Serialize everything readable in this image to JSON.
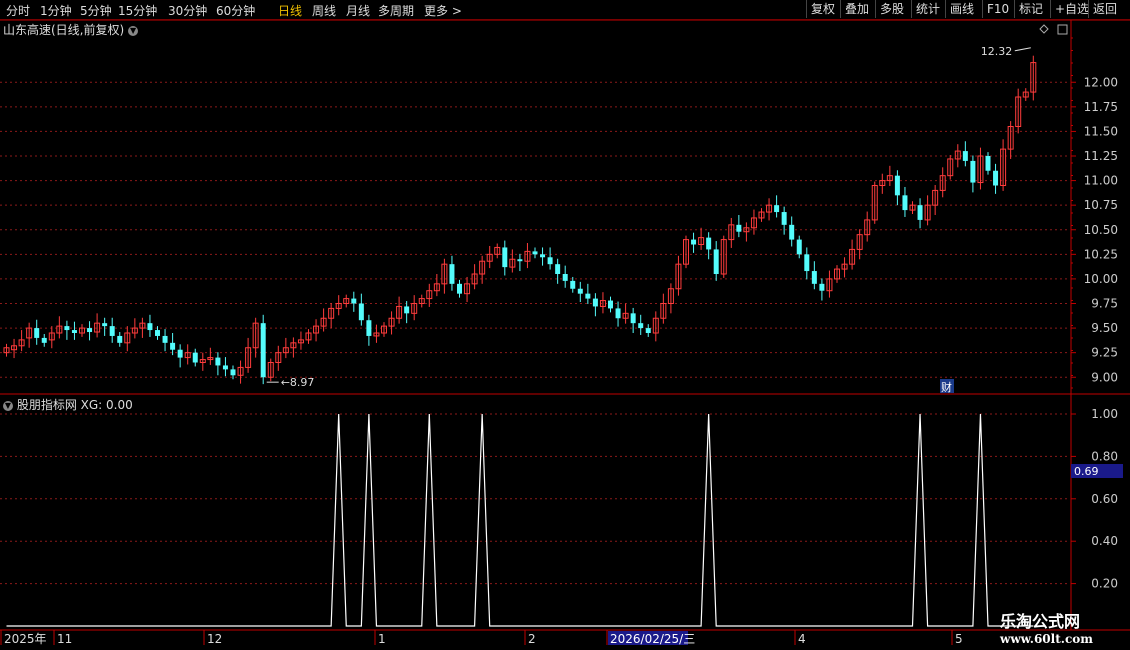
{
  "toolbar": {
    "periods": [
      "分时",
      "1分钟",
      "5分钟",
      "15分钟",
      "30分钟",
      "60分钟",
      "日线",
      "周线",
      "月线",
      "多周期",
      "更多"
    ],
    "active_period": "日线",
    "right_buttons": [
      "复权",
      "叠加",
      "多股",
      "统计",
      "画线",
      "F10",
      "标记",
      "+自选",
      "返回"
    ]
  },
  "main_chart": {
    "title": "山东高速(日线,前复权)",
    "high_label": "12.32",
    "low_label": "8.97",
    "event_badge": "财"
  },
  "indicator": {
    "title": "股朋指标网 XG: 0.00",
    "current_value": "0.69"
  },
  "time_axis": {
    "labels": [
      "2025年",
      "11",
      "12",
      "1",
      "2",
      "2026/02/25/三",
      "4",
      "5"
    ]
  },
  "watermark": {
    "line1": "乐淘公式网",
    "line2": "www.60lt.com"
  },
  "colors": {
    "up": "#ff3c3c",
    "down": "#54fcfc",
    "grid": "#8b1a1a",
    "axis": "#c00000"
  },
  "chart_data": [
    {
      "type": "candlestick",
      "title": "山东高速(日线,前复权)",
      "y_ticks": [
        9.0,
        9.25,
        9.5,
        9.75,
        10.0,
        10.25,
        10.5,
        10.75,
        11.0,
        11.25,
        11.5,
        11.75,
        12.0
      ],
      "ylim": [
        8.85,
        12.45
      ],
      "close": [
        9.3,
        9.32,
        9.38,
        9.5,
        9.4,
        9.35,
        9.45,
        9.52,
        9.48,
        9.45,
        9.5,
        9.46,
        9.55,
        9.52,
        9.42,
        9.35,
        9.45,
        9.5,
        9.55,
        9.48,
        9.42,
        9.35,
        9.28,
        9.2,
        9.25,
        9.15,
        9.18,
        9.2,
        9.12,
        9.08,
        9.02,
        9.1,
        9.3,
        9.55,
        9.0,
        9.15,
        9.25,
        9.3,
        9.35,
        9.38,
        9.45,
        9.52,
        9.6,
        9.7,
        9.75,
        9.8,
        9.75,
        9.58,
        9.42,
        9.45,
        9.52,
        9.6,
        9.72,
        9.65,
        9.75,
        9.8,
        9.88,
        9.95,
        10.15,
        9.95,
        9.85,
        9.95,
        10.05,
        10.18,
        10.25,
        10.32,
        10.12,
        10.2,
        10.18,
        10.28,
        10.25,
        10.22,
        10.15,
        10.05,
        9.98,
        9.9,
        9.85,
        9.8,
        9.72,
        9.78,
        9.7,
        9.6,
        9.65,
        9.55,
        9.5,
        9.45,
        9.6,
        9.75,
        9.9,
        10.15,
        10.4,
        10.35,
        10.42,
        10.3,
        10.05,
        10.4,
        10.55,
        10.48,
        10.52,
        10.62,
        10.68,
        10.75,
        10.68,
        10.55,
        10.4,
        10.25,
        10.08,
        9.95,
        9.88,
        10.0,
        10.1,
        10.15,
        10.3,
        10.45,
        10.6,
        10.95,
        11.0,
        11.05,
        10.85,
        10.7,
        10.75,
        10.6,
        10.75,
        10.9,
        11.05,
        11.22,
        11.3,
        11.2,
        10.98,
        11.25,
        11.1,
        10.95,
        11.32,
        11.55,
        11.85,
        11.9,
        12.2
      ],
      "open": [
        9.25,
        9.28,
        9.32,
        9.4,
        9.5,
        9.4,
        9.38,
        9.45,
        9.52,
        9.48,
        9.45,
        9.5,
        9.46,
        9.55,
        9.52,
        9.42,
        9.35,
        9.45,
        9.5,
        9.55,
        9.48,
        9.42,
        9.35,
        9.28,
        9.2,
        9.25,
        9.15,
        9.18,
        9.2,
        9.12,
        9.08,
        9.02,
        9.1,
        9.3,
        9.55,
        9.0,
        9.15,
        9.25,
        9.3,
        9.35,
        9.38,
        9.45,
        9.52,
        9.6,
        9.7,
        9.75,
        9.8,
        9.75,
        9.58,
        9.42,
        9.45,
        9.52,
        9.6,
        9.72,
        9.65,
        9.75,
        9.8,
        9.88,
        9.95,
        10.15,
        9.95,
        9.85,
        9.95,
        10.05,
        10.18,
        10.25,
        10.32,
        10.12,
        10.2,
        10.18,
        10.28,
        10.25,
        10.22,
        10.15,
        10.05,
        9.98,
        9.9,
        9.85,
        9.8,
        9.72,
        9.78,
        9.7,
        9.6,
        9.65,
        9.55,
        9.5,
        9.45,
        9.6,
        9.75,
        9.9,
        10.15,
        10.4,
        10.35,
        10.42,
        10.3,
        10.05,
        10.4,
        10.55,
        10.48,
        10.52,
        10.62,
        10.68,
        10.75,
        10.68,
        10.55,
        10.4,
        10.25,
        10.08,
        9.95,
        9.88,
        10.0,
        10.1,
        10.15,
        10.3,
        10.45,
        10.6,
        10.95,
        11.0,
        11.05,
        10.85,
        10.7,
        10.75,
        10.6,
        10.75,
        10.9,
        11.05,
        11.22,
        11.3,
        11.2,
        10.98,
        11.25,
        11.1,
        10.95,
        11.32,
        11.55,
        11.85,
        11.9
      ],
      "bars": 138
    },
    {
      "type": "line",
      "title": "股朋指标网 XG",
      "y_ticks": [
        0.2,
        0.4,
        0.6,
        0.8,
        1.0
      ],
      "spike_bars": [
        44,
        48,
        56,
        63,
        93,
        121,
        129
      ],
      "values_default": 0,
      "spike_value": 1.0
    }
  ]
}
